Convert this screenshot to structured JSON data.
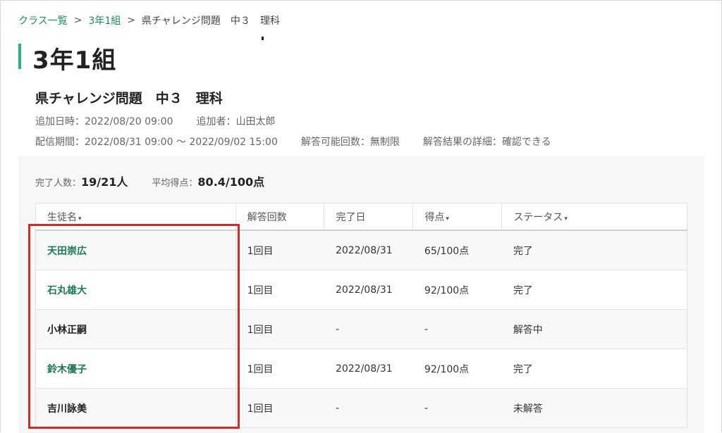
{
  "breadcrumb": {
    "item1": "クラス一覧",
    "item2": "3年1組",
    "current": "県チャレンジ問題　中３　理科",
    "separator": ">"
  },
  "page": {
    "title": "3年1組"
  },
  "assignment": {
    "title": "県チャレンジ問題　中３　理科",
    "added_at": "追加日時：2022/08/20 09:00",
    "added_by": "追加者：山田太郎",
    "period": "配信期間：2022/08/31 09:00 〜 2022/09/02 15:00",
    "attempts_allowed": "解答可能回数：無制限",
    "result_detail": "解答結果の詳細：確認できる"
  },
  "summary": {
    "completed_label": "完了人数：",
    "completed_value": "19/21人",
    "average_label": "平均得点：",
    "average_value": "80.4/100点"
  },
  "table": {
    "headers": {
      "name": "生徒名",
      "attempts": "解答回数",
      "date": "完了日",
      "score": "得点",
      "status": "ステータス",
      "sort_caret": "▾"
    },
    "rows": [
      {
        "name": "天田崇広",
        "attempts": "1回目",
        "date": "2022/08/31",
        "score": "65/100点",
        "status": "完了"
      },
      {
        "name": "石丸雄大",
        "attempts": "1回目",
        "date": "2022/08/31",
        "score": "92/100点",
        "status": "完了"
      },
      {
        "name": "小林正嗣",
        "attempts": "1回目",
        "date": "-",
        "score": "-",
        "status": "解答中"
      },
      {
        "name": "鈴木優子",
        "attempts": "1回目",
        "date": "2022/08/31",
        "score": "92/100点",
        "status": "完了"
      },
      {
        "name": "吉川詠美",
        "attempts": "1回目",
        "date": "-",
        "score": "-",
        "status": "未解答"
      }
    ]
  },
  "colors": {
    "accent": "#1f8a5e",
    "title_bar": "#2bb37e",
    "highlight": "#d22a2a"
  }
}
